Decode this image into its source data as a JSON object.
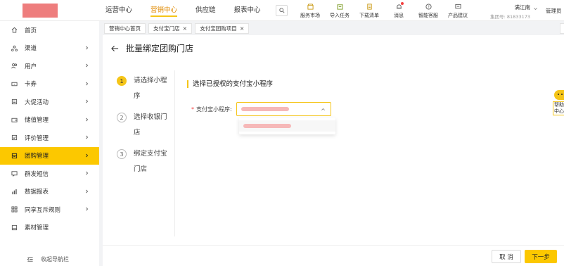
{
  "topbar": {
    "nav": [
      "运营中心",
      "营销中心",
      "供应链",
      "报表中心"
    ],
    "active_nav_index": 1,
    "tools": [
      {
        "label": "服务市场",
        "icon": "market-icon"
      },
      {
        "label": "导入任务",
        "icon": "import-icon"
      },
      {
        "label": "下载清单",
        "icon": "download-icon"
      },
      {
        "label": "消息",
        "icon": "bell-icon",
        "badge": true
      },
      {
        "label": "智能客服",
        "icon": "help-circle-icon"
      },
      {
        "label": "产品建议",
        "icon": "feedback-icon"
      }
    ],
    "user_name": "满江南",
    "group_id": "集团号: 81833173",
    "admin_label": "管理员"
  },
  "sidebar": {
    "items": [
      {
        "label": "首页",
        "icon": "home-icon",
        "arrow": false
      },
      {
        "label": "渠道",
        "icon": "channel-icon",
        "arrow": true
      },
      {
        "label": "用户",
        "icon": "users-icon",
        "arrow": true
      },
      {
        "label": "卡券",
        "icon": "coupon-icon",
        "arrow": true
      },
      {
        "label": "大促活动",
        "icon": "promo-icon",
        "arrow": true
      },
      {
        "label": "储值管理",
        "icon": "wallet-icon",
        "arrow": true
      },
      {
        "label": "评价管理",
        "icon": "review-icon",
        "arrow": true
      },
      {
        "label": "团购管理",
        "icon": "groupbuy-icon",
        "arrow": true,
        "active": true
      },
      {
        "label": "群发短信",
        "icon": "sms-icon",
        "arrow": true
      },
      {
        "label": "数据报表",
        "icon": "chart-icon",
        "arrow": true
      },
      {
        "label": "同享互斥规则",
        "icon": "rules-icon",
        "arrow": true
      },
      {
        "label": "素材管理",
        "icon": "material-icon",
        "arrow": false
      }
    ],
    "collapse_label": "收起导航栏"
  },
  "tabs": [
    {
      "label": "营销中心首页",
      "closable": false
    },
    {
      "label": "支付宝门店",
      "closable": true
    },
    {
      "label": "支付宝团购项目",
      "closable": true
    }
  ],
  "page": {
    "title": "批量绑定团购门店",
    "steps": [
      {
        "num": "1",
        "label": "请选择小程序",
        "active": true
      },
      {
        "num": "2",
        "label": "选择收银门店",
        "active": false
      },
      {
        "num": "3",
        "label": "绑定支付宝门店",
        "active": false
      }
    ],
    "section_title": "选择已授权的支付宝小程序",
    "field_label": "支付宝小程序:",
    "required_mark": "*",
    "cancel_label": "取 消",
    "next_label": "下一步"
  },
  "help_widget": {
    "text": "帮助中心"
  },
  "colors": {
    "accent": "#fcc800",
    "active_nav_text": "#e08a00",
    "badge": "#f43f3f"
  }
}
